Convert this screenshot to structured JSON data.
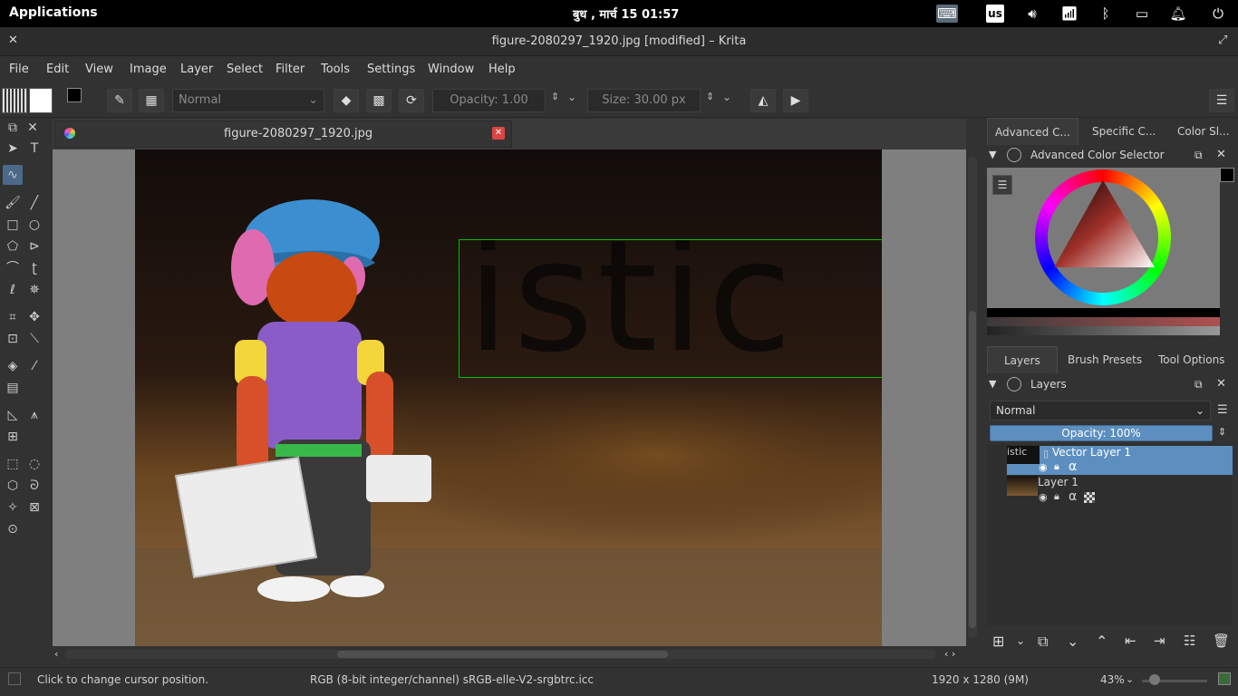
{
  "system_bar": {
    "applications": "Applications",
    "clock": "बुध , मार्च 15   01:57",
    "keyboard_layout": "us"
  },
  "window": {
    "title": "figure-2080297_1920.jpg [modified] – Krita"
  },
  "menu": [
    "File",
    "Edit",
    "View",
    "Image",
    "Layer",
    "Select",
    "Filter",
    "Tools",
    "Settings",
    "Window",
    "Help"
  ],
  "toolbar": {
    "blend_mode": "Normal",
    "opacity": "Opacity:  1.00",
    "size": "Size:  30.00 px"
  },
  "document_tab": {
    "label": "figure-2080297_1920.jpg"
  },
  "canvas": {
    "overlay_text": "istic"
  },
  "color_panel": {
    "tabs": [
      "Advanced C...",
      "Specific C...",
      "Color Sl..."
    ],
    "title": "Advanced Color Selector"
  },
  "layers_panel": {
    "tabs": [
      "Layers",
      "Brush Presets",
      "Tool Options"
    ],
    "title": "Layers",
    "blend_mode": "Normal",
    "opacity": "Opacity:  100%",
    "layers": [
      {
        "name": "Vector Layer 1",
        "thumb_text": "istic"
      },
      {
        "name": "Layer 1"
      }
    ]
  },
  "status": {
    "hint": "Click to change cursor position.",
    "color_profile": "RGB (8-bit integer/channel)  sRGB-elle-V2-srgbtrc.icc",
    "dimensions": "1920 x 1280 (9M)",
    "zoom": "43%"
  },
  "colors": {
    "accent": "#5c8fc0",
    "selection_box": "#00c000"
  }
}
